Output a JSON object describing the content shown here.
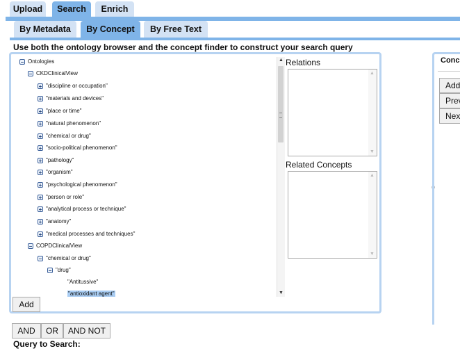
{
  "tabs": [
    "Upload",
    "Search",
    "Enrich"
  ],
  "subtabs": [
    "By Metadata",
    "By Concept",
    "By Free Text"
  ],
  "instruction": "Use both the ontology browser and the concept finder to construct your search query",
  "tree": {
    "root": "Ontologies",
    "ckd": "CKDClinicalView",
    "ckd_items": [
      "\"discipline or occupation\"",
      "\"materials and devices\"",
      "\"place or time\"",
      "\"natural phenomenon\"",
      "\"chemical or drug\"",
      "\"socio-political phenomenon\"",
      "\"pathology\"",
      "\"organism\"",
      "\"psychological phenomenon\"",
      "\"person or role\"",
      "\"analytical process or technique\"",
      "\"anatomy\"",
      "\"medical processes and techniques\""
    ],
    "copd": "COPDClinicalView",
    "copd_chem": "\"chemical or drug\"",
    "copd_drug": "\"drug\"",
    "leaf1": "\"Antitussive\"",
    "leaf2": "\"antioxidant agent\""
  },
  "add_label": "Add",
  "relations_label": "Relations",
  "related_concepts_label": "Related Concepts",
  "right_panel": {
    "title": "Conc",
    "buttons": [
      "Add",
      "Prev",
      "Nex"
    ]
  },
  "ops": [
    "AND",
    "OR",
    "AND NOT"
  ],
  "query_label": "Query to Search:"
}
